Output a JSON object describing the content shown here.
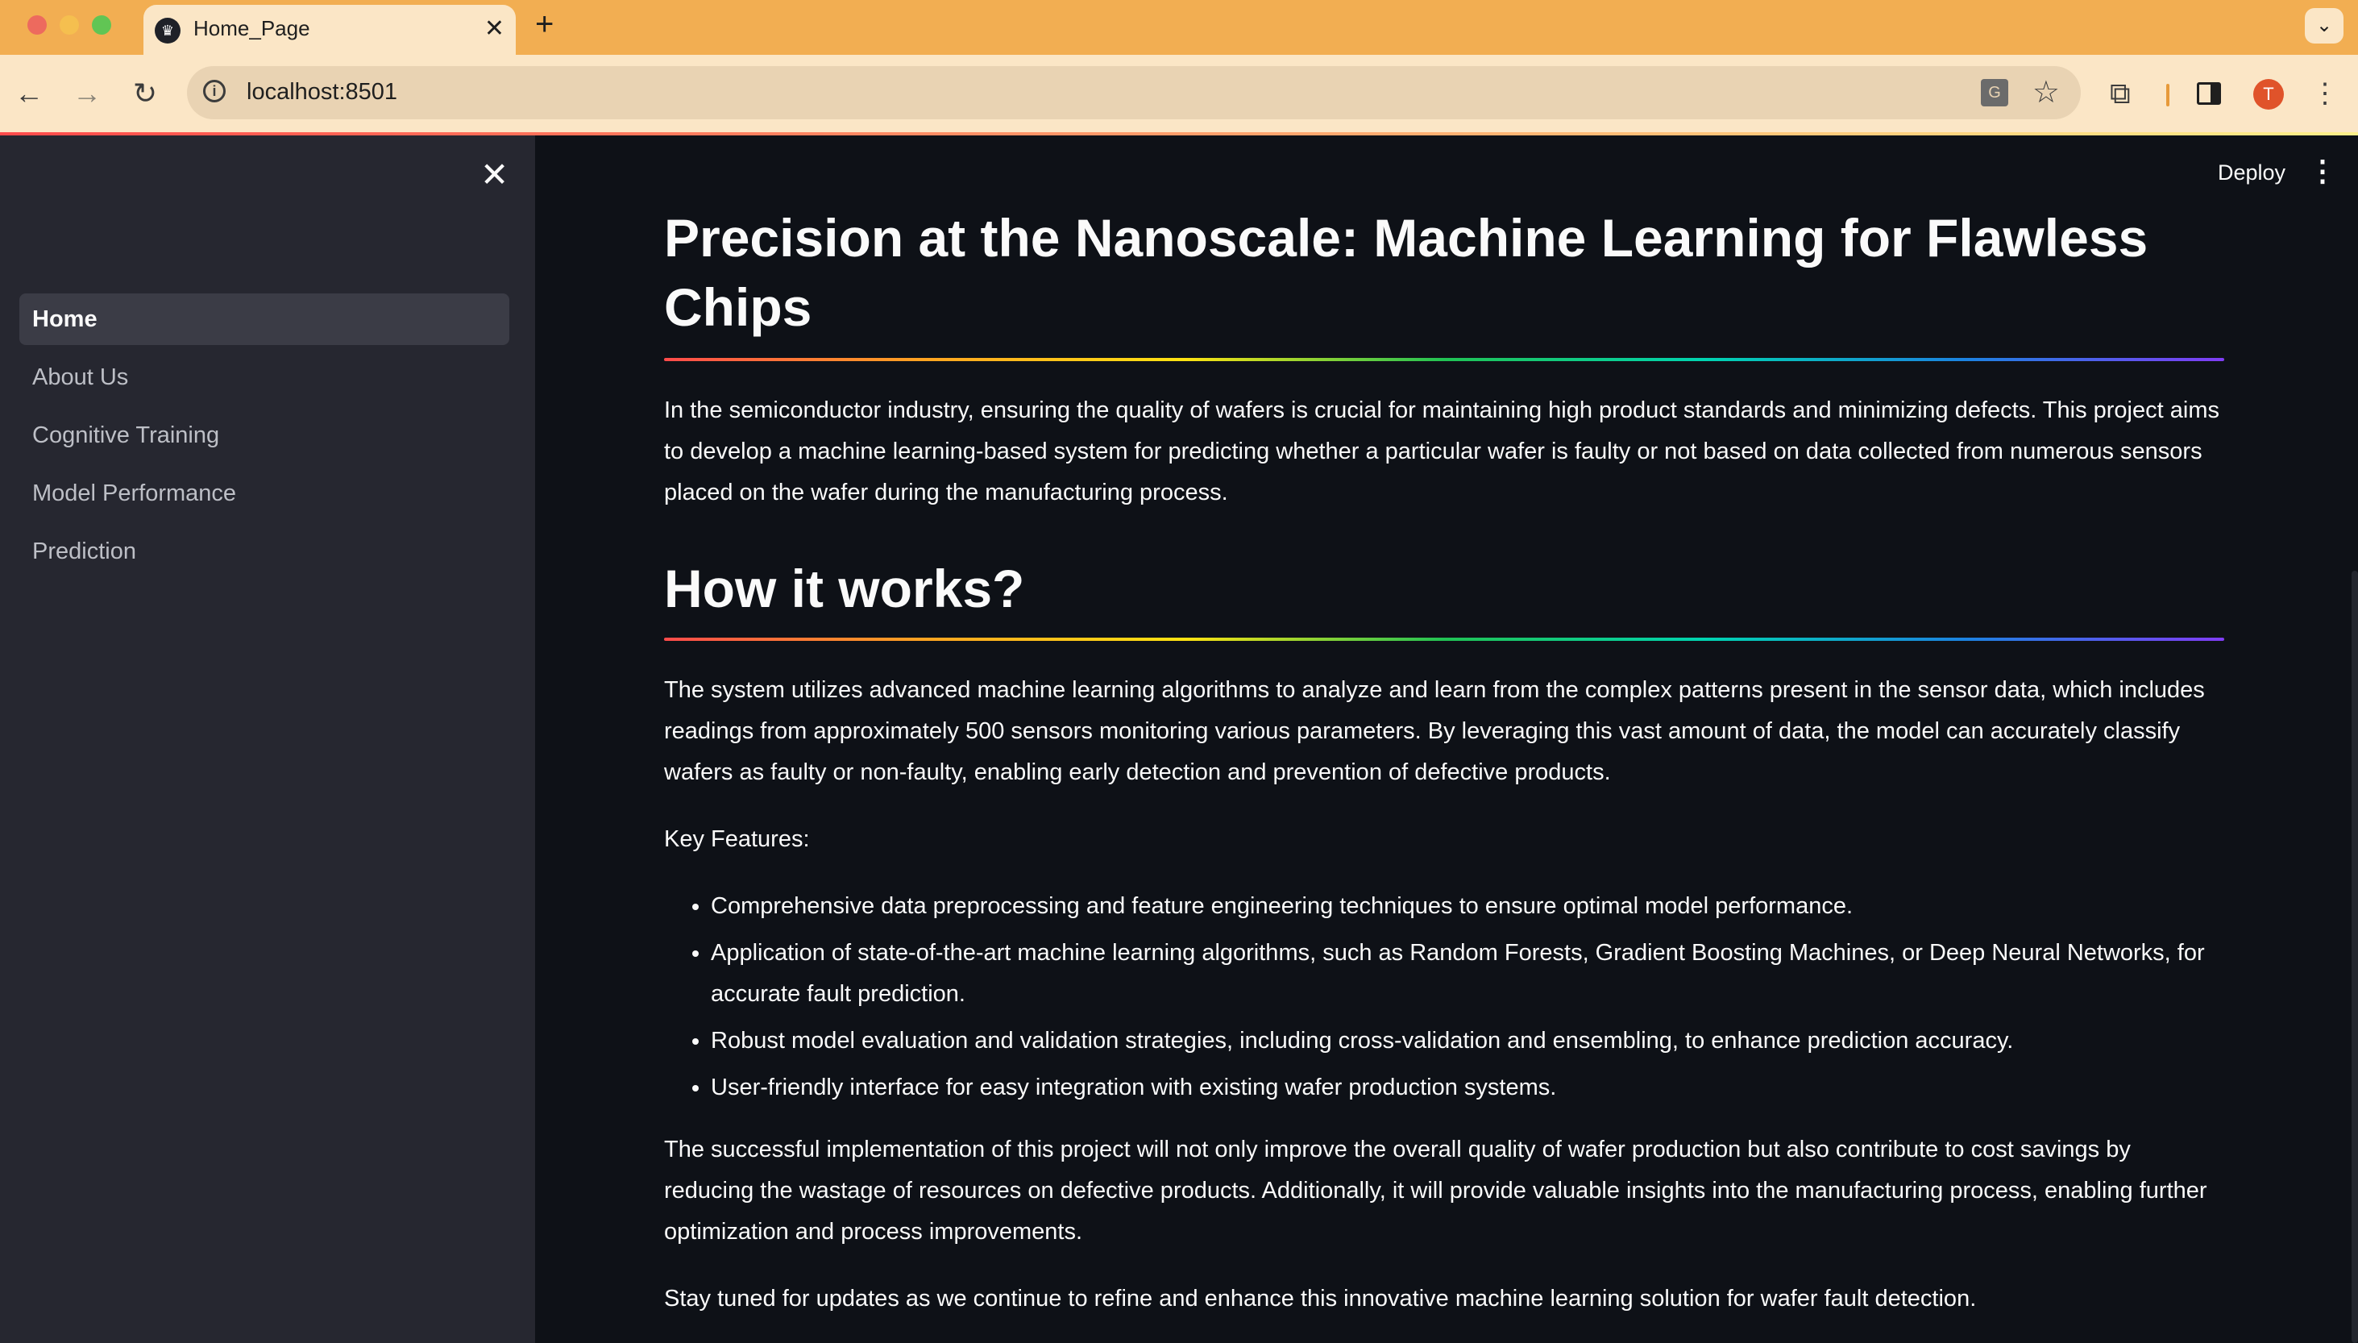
{
  "browser": {
    "tab_title": "Home_Page",
    "tab_favicon": "streamlit-crown-icon",
    "new_tab_label": "+",
    "url": "localhost:8501",
    "avatar_initial": "T"
  },
  "sidebar": {
    "items": [
      {
        "label": "Home",
        "active": true
      },
      {
        "label": "About Us",
        "active": false
      },
      {
        "label": "Cognitive Training",
        "active": false
      },
      {
        "label": "Model Performance",
        "active": false
      },
      {
        "label": "Prediction",
        "active": false
      }
    ]
  },
  "header": {
    "deploy_label": "Deploy"
  },
  "main": {
    "title": "Precision at the Nanoscale: Machine Learning for Flawless Chips",
    "intro": "In the semiconductor industry, ensuring the quality of wafers is crucial for maintaining high product standards and minimizing defects. This project aims to develop a machine learning-based system for predicting whether a particular wafer is faulty or not based on data collected from numerous sensors placed on the wafer during the manufacturing process.",
    "how_title": "How it works?",
    "how_text": "The system utilizes advanced machine learning algorithms to analyze and learn from the complex patterns present in the sensor data, which includes readings from approximately 500 sensors monitoring various parameters. By leveraging this vast amount of data, the model can accurately classify wafers as faulty or non-faulty, enabling early detection and prevention of defective products.",
    "features_label": "Key Features:",
    "features": [
      "Comprehensive data preprocessing and feature engineering techniques to ensure optimal model performance.",
      "Application of state-of-the-art machine learning algorithms, such as Random Forests, Gradient Boosting Machines, or Deep Neural Networks, for accurate fault prediction.",
      "Robust model evaluation and validation strategies, including cross-validation and ensembling, to enhance prediction accuracy.",
      "User-friendly interface for easy integration with existing wafer production systems."
    ],
    "outcome": "The successful implementation of this project will not only improve the overall quality of wafer production but also contribute to cost savings by reducing the wastage of resources on defective products. Additionally, it will provide valuable insights into the manufacturing process, enabling further optimization and process improvements.",
    "closing": "Stay tuned for updates as we continue to refine and enhance this innovative machine learning solution for wafer fault detection."
  },
  "colors": {
    "tabbar": "#f2ae52",
    "toolbar": "#fbe6c6",
    "sidebar": "#262730",
    "main_bg": "#0e1117",
    "text": "#fafafa"
  }
}
